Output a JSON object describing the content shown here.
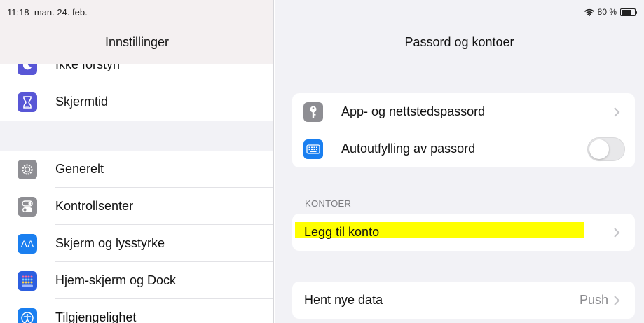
{
  "status": {
    "time": "11:18",
    "date": "man. 24. feb.",
    "battery": "80 %",
    "battery_level": 0.8
  },
  "left": {
    "title": "Innstillinger",
    "items": [
      {
        "label": "Ikke forstyrr",
        "icon": "moon-icon",
        "color": "#5856d6"
      },
      {
        "label": "Skjermtid",
        "icon": "hourglass-icon",
        "color": "#5856d6"
      },
      {
        "label": "Generelt",
        "icon": "gear-icon",
        "color": "#8e8e93"
      },
      {
        "label": "Kontrollsenter",
        "icon": "switches-icon",
        "color": "#8e8e93"
      },
      {
        "label": "Skjerm og lysstyrke",
        "icon": "display-aa-icon",
        "icon_text": "AA",
        "color": "#1a7ff0"
      },
      {
        "label": "Hjem-skjerm og Dock",
        "icon": "home-grid-icon",
        "color": "#2c5fe0"
      },
      {
        "label": "Tilgjengelighet",
        "icon": "accessibility-icon",
        "color": "#1a7ff0"
      }
    ]
  },
  "right": {
    "title": "Passord og kontoer",
    "group1": [
      {
        "label": "App- og nettstedspassord",
        "icon": "key-icon",
        "color": "#8e8e93"
      },
      {
        "label": "Autoutfylling av passord",
        "icon": "keyboard-icon",
        "color": "#1a7ff0",
        "toggle_on": false
      }
    ],
    "section": "KONTOER",
    "add_account": "Legg til konto",
    "highlight_color": "#ffff00",
    "fetch": {
      "label": "Hent nye data",
      "value": "Push"
    }
  }
}
